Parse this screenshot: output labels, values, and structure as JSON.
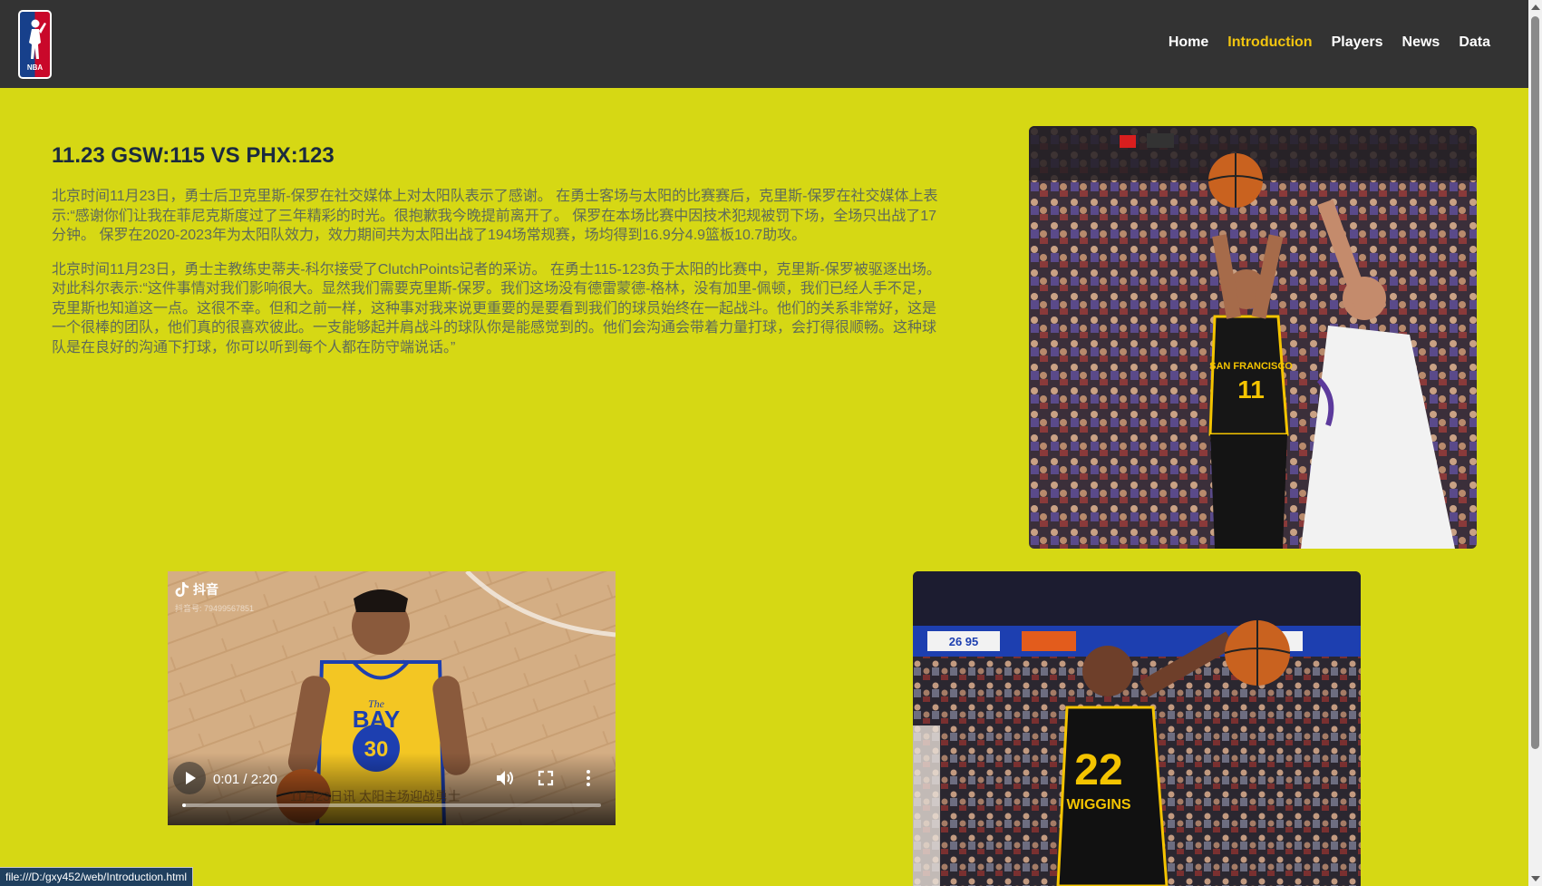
{
  "header": {
    "logo_text": "NBA",
    "nav": [
      {
        "label": "Home",
        "active": false
      },
      {
        "label": "Introduction",
        "active": true
      },
      {
        "label": "Players",
        "active": false
      },
      {
        "label": "News",
        "active": false
      },
      {
        "label": "Data",
        "active": false
      }
    ]
  },
  "article": {
    "title": "11.23 GSW:115 VS PHX:123",
    "paragraphs": [
      "北京时间11月23日，勇士后卫克里斯-保罗在社交媒体上对太阳队表示了感谢。 在勇士客场与太阳的比赛赛后，克里斯-保罗在社交媒体上表示:“感谢你们让我在菲尼克斯度过了三年精彩的时光。很抱歉我今晚提前离开了。 保罗在本场比赛中因技术犯规被罚下场，全场只出战了17分钟。 保罗在2020-2023年为太阳队效力，效力期间共为太阳出战了194场常规赛，场均得到16.9分4.9篮板10.7助攻。",
      "北京时间11月23日，勇士主教练史蒂夫-科尔接受了ClutchPoints记者的采访。 在勇士115-123负于太阳的比赛中，克里斯-保罗被驱逐出场。对此科尔表示:“这件事情对我们影响很大。显然我们需要克里斯-保罗。我们这场没有德雷蒙德-格林，没有加里-佩顿，我们已经人手不足，克里斯也知道这一点。这很不幸。但和之前一样，这种事对我来说更重要的是要看到我们的球员始终在一起战斗。他们的关系非常好，这是一个很棒的团队，他们真的很喜欢彼此。一支能够起并肩战斗的球队你是能感觉到的。他们会沟通会带着力量打球，会打得很顺畅。这种球队是在良好的沟通下打球，你可以听到每个人都在防守端说话。”"
    ]
  },
  "photo1": {
    "jersey_top": "SAN FRANCISCO",
    "jersey_number": "11"
  },
  "photo2": {
    "jersey_number": "22",
    "jersey_name": "WIGGINS",
    "scoreboard": "26 95"
  },
  "video": {
    "brand": "抖音",
    "account": "抖音号: 79499567851",
    "jersey_top": "The",
    "jersey_text": "BAY",
    "jersey_number": "30",
    "subtitle": "11月23日讯 太阳主场迎战勇士",
    "time": "0:01 / 2:20",
    "progress": 0.008
  },
  "status_bar": {
    "url": "file:///D:/gxy452/web/Introduction.html"
  },
  "colors": {
    "page_background": "#d6d814",
    "header_background": "#333333",
    "nav_active": "#f1c40f",
    "title": "#1b2a3f",
    "body_text": "#5f6a5a"
  }
}
